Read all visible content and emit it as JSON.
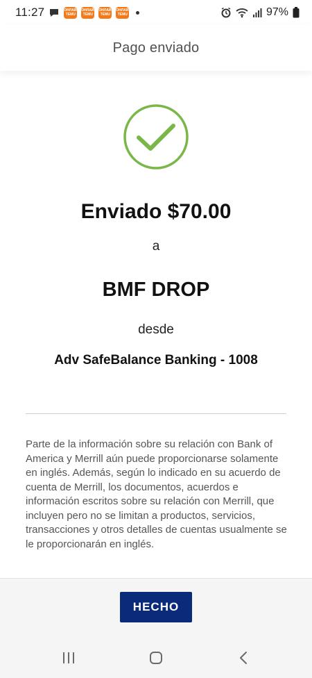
{
  "status_bar": {
    "time": "11:27",
    "battery": "97%",
    "notification_app_text": "ОНЛАЙН ТЕМU"
  },
  "header": {
    "title": "Pago enviado"
  },
  "confirmation": {
    "sent_amount": "Enviado $70.00",
    "to_word": "a",
    "recipient": "BMF DROP",
    "from_word": "desde",
    "account": "Adv SafeBalance Banking - 1008"
  },
  "disclaimer": {
    "text": "Parte de la información sobre su relación con Bank of America y Merrill aún puede proporcionarse solamente en inglés. Además, según lo indicado en su acuerdo de cuenta de Merrill, los documentos, acuerdos e información escritos sobre su relación con Merrill, que incluyen pero no se limitan a productos, servicios, transacciones y otros detalles de cuentas usualmente se le proporcionarán en inglés."
  },
  "footer": {
    "done_label": "HECHO"
  },
  "colors": {
    "accent_green": "#7ab648",
    "button_navy": "#0a2a7a",
    "notification_orange": "#f27a1a"
  }
}
